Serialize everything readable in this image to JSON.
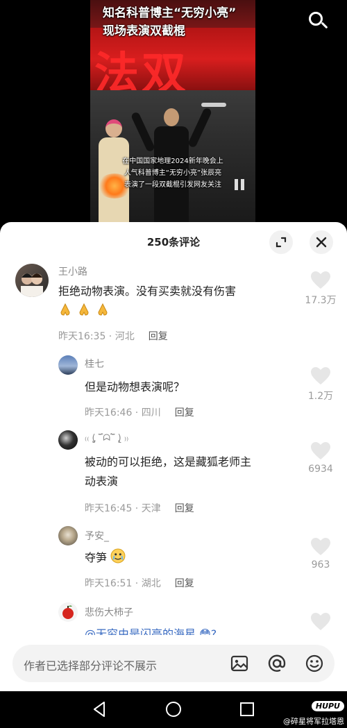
{
  "video": {
    "title_line1": "知名科普博主“无穷小亮”",
    "title_line2": "现场表演双截棍",
    "caption_line1": "在中国国家地理2024新年晚会上",
    "caption_line2": "人气科普博主“无穷小亮”张辰亮",
    "caption_line3": "表演了一段双截棍引发网友关注",
    "stage_text": "法双"
  },
  "header_icons": [
    "search-icon"
  ],
  "sheet": {
    "title": "250条评论",
    "expand_icon": "expand-icon",
    "close_icon": "close-icon"
  },
  "comments": [
    {
      "user": "王小路",
      "text": "拒绝动物表演。没有买卖就没有伤害",
      "emoji": [
        "pray",
        "pray",
        "pray"
      ],
      "time": "昨天16:35 · 河北",
      "reply": "回复",
      "likes": "17.3万"
    },
    {
      "user": "桂七",
      "text": "但是动物想表演呢？",
      "time": "昨天16:46 · 四川",
      "reply": "回复",
      "likes": "1.2万"
    },
    {
      "user": "₍₍ (̨̡ ‾᷄ᗣ‾᷅ )̧̢ ₎₎",
      "text_line1": "被动的可以拒绝，这是藏狐老师主",
      "text_line2": "动表演",
      "time": "昨天16:45 · 天津",
      "reply": "回复",
      "likes": "6934"
    },
    {
      "user": "予安_",
      "text": "夺笋",
      "emoji": [
        "cry-smile"
      ],
      "time": "昨天16:51 · 湖北",
      "reply": "回复",
      "likes": "963"
    },
    {
      "user": "悲伤大柿子",
      "text": "@无穷由是闪亮的海星 😳?",
      "likes": ""
    }
  ],
  "input": {
    "placeholder": "作者已选择部分评论不展示",
    "icons": [
      "image-icon",
      "at-icon",
      "emoji-icon"
    ]
  },
  "nav": {
    "icons": [
      "back-icon",
      "home-icon",
      "recents-icon"
    ]
  },
  "watermark": {
    "logo": "HUPU",
    "text": "@碎星将军拉塔恩"
  },
  "colors": {
    "mention": "#3b6cc2",
    "meta_gray": "#9a9a9a",
    "sheet_bg": "#ffffff"
  }
}
